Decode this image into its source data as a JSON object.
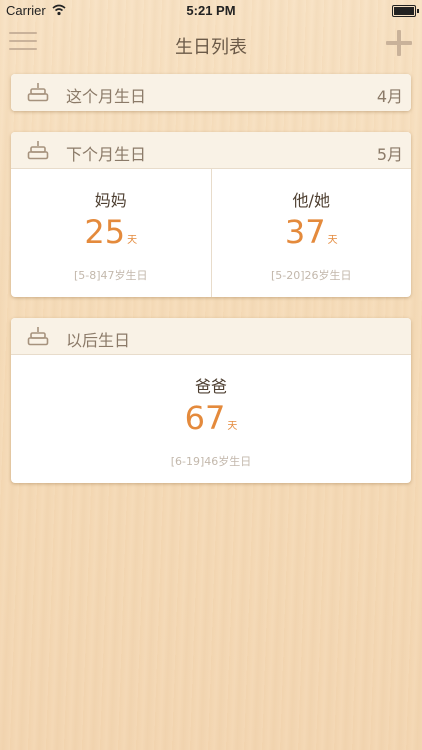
{
  "status": {
    "carrier": "Carrier",
    "time": "5:21 PM"
  },
  "nav": {
    "title": "生日列表"
  },
  "sections": [
    {
      "label": "这个月生日",
      "month": "4月"
    },
    {
      "label": "下个月生日",
      "month": "5月",
      "people": [
        {
          "name": "妈妈",
          "days": "25",
          "unit": "天",
          "info": "[5-8]47岁生日"
        },
        {
          "name": "他/她",
          "days": "37",
          "unit": "天",
          "info": "[5-20]26岁生日"
        }
      ]
    },
    {
      "label": "以后生日",
      "month": "",
      "people": [
        {
          "name": "爸爸",
          "days": "67",
          "unit": "天",
          "info": "[6-19]46岁生日"
        }
      ]
    }
  ],
  "colors": {
    "accent": "#e48a3c",
    "header_bg": "#f9f2e6"
  },
  "icons": [
    "wifi-icon",
    "battery-icon",
    "menu-icon",
    "plus-icon",
    "cake-icon"
  ]
}
